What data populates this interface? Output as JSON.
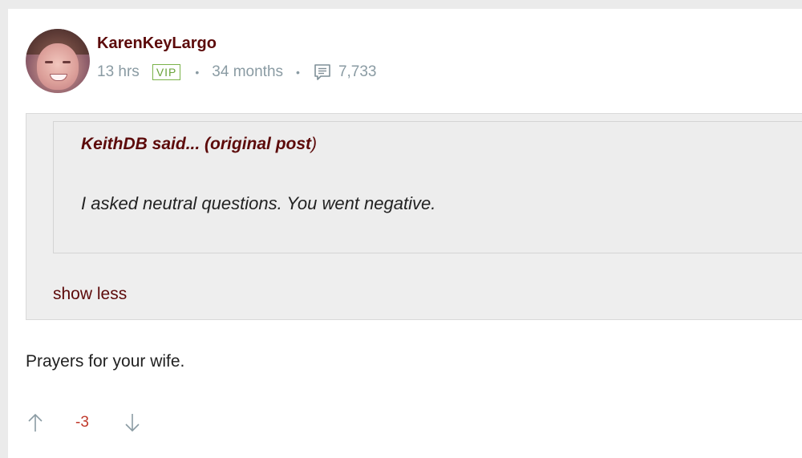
{
  "post": {
    "author": "KarenKeyLargo",
    "time": "13 hrs",
    "badge": "VIP",
    "tenure": "34 months",
    "comment_count": "7,733",
    "separator": "•",
    "quote": {
      "author": "KeithDB",
      "said": " said... (",
      "original_post_label": "original post",
      "close": ")",
      "text": "I asked neutral questions. You went negative."
    },
    "show_less_label": "show less",
    "body": "Prayers for your wife.",
    "score": "-3"
  },
  "colors": {
    "accent": "#5c0a0a",
    "meta": "#8a9ba3",
    "vip": "#6aa33a",
    "negative_score": "#c0392b"
  },
  "icons": {
    "comment": "comment-icon",
    "upvote": "arrow-up-icon",
    "downvote": "arrow-down-icon"
  }
}
